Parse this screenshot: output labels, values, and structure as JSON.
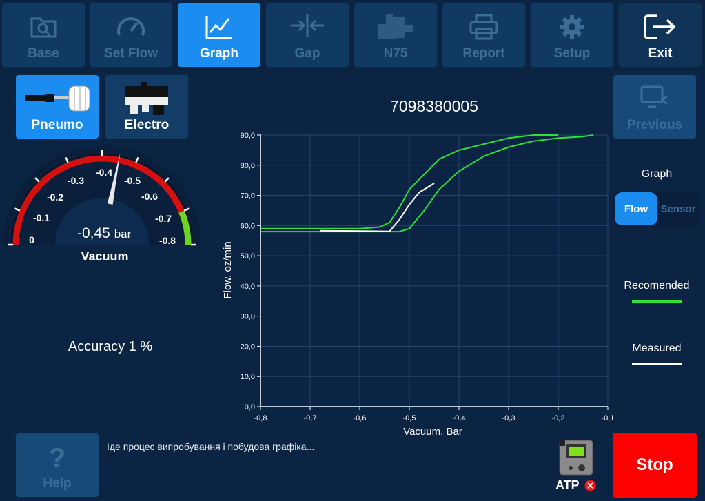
{
  "toolbar": {
    "base": "Base",
    "set_flow": "Set Flow",
    "graph": "Graph",
    "gap": "Gap",
    "n75": "N75",
    "report": "Report",
    "setup": "Setup",
    "exit": "Exit"
  },
  "mode": {
    "pneumo": "Pneumo",
    "electro": "Electro"
  },
  "previous": "Previous",
  "part_number": "7098380005",
  "gauge": {
    "value_text": "-0,45",
    "unit": "bar",
    "label": "Vacuum",
    "value": -0.45,
    "ticks": [
      "0",
      "-0.1",
      "-0.2",
      "-0.3",
      "-0.4",
      "-0.5",
      "-0.6",
      "-0.7",
      "-0.8"
    ]
  },
  "accuracy": "Accuracy 1 %",
  "graph_panel": {
    "title": "Graph",
    "flow": "Flow",
    "sensor": "Sensor",
    "legend_recommended": "Recomended",
    "legend_measured": "Measured"
  },
  "status_text": "Іде процес випробування і побудова графіка...",
  "help": "Help",
  "atp": "ATP",
  "stop": "Stop",
  "colors": {
    "recommended": "#2ee03a",
    "measured": "#ffffff",
    "stop": "#ff0000",
    "accent": "#1b8df0"
  },
  "chart_data": {
    "type": "line",
    "xlabel": "Vacuum, Bar",
    "ylabel": "Flow, oz/min",
    "xlim": [
      -0.8,
      -0.1
    ],
    "ylim": [
      0,
      90
    ],
    "x_ticks": [
      "-0,8",
      "-0,7",
      "-0,6",
      "-0,5",
      "-0,4",
      "-0,3",
      "-0,2",
      "-0,1"
    ],
    "y_ticks": [
      "0,0",
      "10,0",
      "20,0",
      "30,0",
      "40,0",
      "50,0",
      "60,0",
      "70,0",
      "80,0",
      "90,0"
    ],
    "grid": true,
    "series": [
      {
        "name": "Recomended",
        "role": "upper",
        "x": [
          -0.8,
          -0.7,
          -0.6,
          -0.56,
          -0.54,
          -0.52,
          -0.5,
          -0.47,
          -0.44,
          -0.4,
          -0.35,
          -0.3,
          -0.25,
          -0.2
        ],
        "y": [
          59,
          59,
          59,
          59.5,
          61,
          66,
          72,
          77,
          82,
          85,
          87,
          89,
          90,
          90
        ]
      },
      {
        "name": "Recomended",
        "role": "lower",
        "x": [
          -0.8,
          -0.7,
          -0.6,
          -0.55,
          -0.52,
          -0.5,
          -0.47,
          -0.44,
          -0.4,
          -0.35,
          -0.3,
          -0.25,
          -0.2,
          -0.15,
          -0.13
        ],
        "y": [
          58,
          58,
          58,
          58,
          58,
          59,
          65,
          72,
          78,
          83,
          86,
          88,
          89,
          89.5,
          90
        ]
      },
      {
        "name": "Measured",
        "x": [
          -0.68,
          -0.6,
          -0.54,
          -0.52,
          -0.5,
          -0.48,
          -0.46,
          -0.45
        ],
        "y": [
          58.3,
          58.2,
          58.1,
          62,
          67,
          71,
          73,
          74
        ]
      }
    ]
  }
}
